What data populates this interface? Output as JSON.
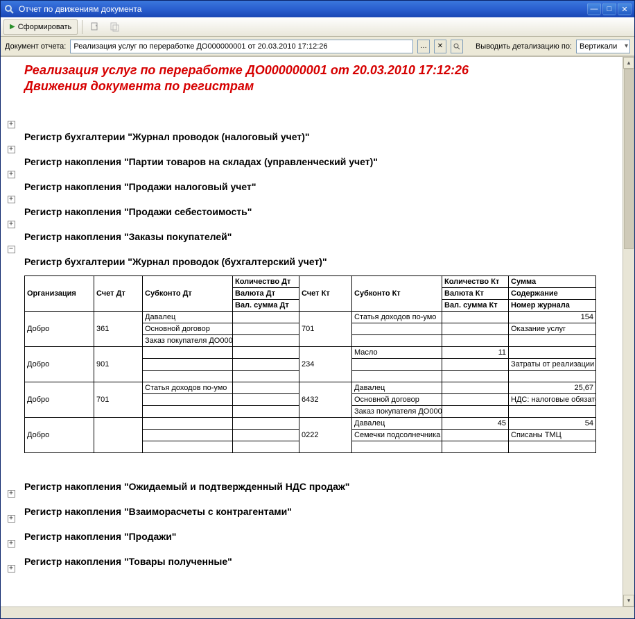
{
  "window": {
    "title": "Отчет по движениям документа"
  },
  "toolbar": {
    "generate": "Сформировать"
  },
  "filter": {
    "doc_label": "Документ отчета:",
    "doc_value": "Реализация услуг по переработке ДО000000001 от 20.03.2010 17:12:26",
    "detail_label": "Выводить детализацию по:",
    "detail_value": "Вертикали"
  },
  "report": {
    "title_line1": "Реализация услуг по переработке ДО000000001 от 20.03.2010 17:12:26",
    "title_line2": "Движения документа по регистрам"
  },
  "sections": [
    {
      "expanded": false,
      "title": "Регистр бухгалтерии \"Журнал проводок (налоговый учет)\""
    },
    {
      "expanded": false,
      "title": "Регистр накопления \"Партии товаров на складах (управленческий учет)\""
    },
    {
      "expanded": false,
      "title": "Регистр накопления \"Продажи налоговый учет\""
    },
    {
      "expanded": false,
      "title": "Регистр накопления \"Продажи себестоимость\""
    },
    {
      "expanded": false,
      "title": "Регистр накопления \"Заказы покупателей\""
    },
    {
      "expanded": true,
      "title": "Регистр бухгалтерии \"Журнал проводок (бухгалтерский учет)\""
    },
    {
      "expanded": false,
      "title": "Регистр накопления \"Ожидаемый и подтвержденный НДС продаж\""
    },
    {
      "expanded": false,
      "title": "Регистр накопления \"Взаиморасчеты с контрагентами\""
    },
    {
      "expanded": false,
      "title": "Регистр накопления \"Продажи\""
    },
    {
      "expanded": false,
      "title": "Регистр накопления \"Товары полученные\""
    }
  ],
  "table": {
    "head": {
      "org": "Организация",
      "acc_dt": "Счет Дт",
      "sub_dt": "Субконто Дт",
      "qty_dt": "Количество Дт",
      "cur_dt": "Валюта Дт",
      "valsum_dt": "Вал. сумма Дт",
      "acc_kt": "Счет Кт",
      "sub_kt": "Субконто Кт",
      "qty_kt": "Количество Кт",
      "cur_kt": "Валюта Кт",
      "valsum_kt": "Вал. сумма Кт",
      "sum": "Сумма",
      "content": "Содержание",
      "jrn": "Номер журнала"
    },
    "rows": [
      {
        "org": "Добро",
        "acc_dt": "361",
        "sub_dt": [
          "Давалец",
          "Основной договор",
          "Заказ покупателя ДО000"
        ],
        "qty_dt": [
          "",
          "",
          ""
        ],
        "acc_kt": "701",
        "sub_kt": [
          "Статья доходов по-умо",
          "",
          ""
        ],
        "qty_kt": [
          "",
          "",
          ""
        ],
        "right": [
          "154",
          "Оказание услуг",
          ""
        ]
      },
      {
        "org": "Добро",
        "acc_dt": "901",
        "sub_dt": [
          "",
          "",
          ""
        ],
        "qty_dt": [
          "",
          "",
          ""
        ],
        "acc_kt": "234",
        "sub_kt": [
          "Масло",
          "",
          ""
        ],
        "qty_kt": [
          "11",
          "",
          ""
        ],
        "right": [
          "",
          "Затраты от реализации у",
          ""
        ]
      },
      {
        "org": "Добро",
        "acc_dt": "701",
        "sub_dt": [
          "Статья доходов по-умо",
          "",
          ""
        ],
        "qty_dt": [
          "",
          "",
          ""
        ],
        "acc_kt": "6432",
        "sub_kt": [
          "Давалец",
          "Основной договор",
          "Заказ покупателя ДО000"
        ],
        "qty_kt": [
          "",
          "",
          ""
        ],
        "right": [
          "25,67",
          "НДС: налоговые обязате",
          ""
        ]
      },
      {
        "org": "Добро",
        "acc_dt": "",
        "sub_dt": [
          "",
          "",
          ""
        ],
        "qty_dt": [
          "",
          "",
          ""
        ],
        "acc_kt": "0222",
        "sub_kt": [
          "Давалец",
          "Семечки подсолнечника",
          ""
        ],
        "qty_kt": [
          "45",
          "",
          ""
        ],
        "right": [
          "54",
          "Списаны ТМЦ",
          ""
        ]
      }
    ]
  }
}
